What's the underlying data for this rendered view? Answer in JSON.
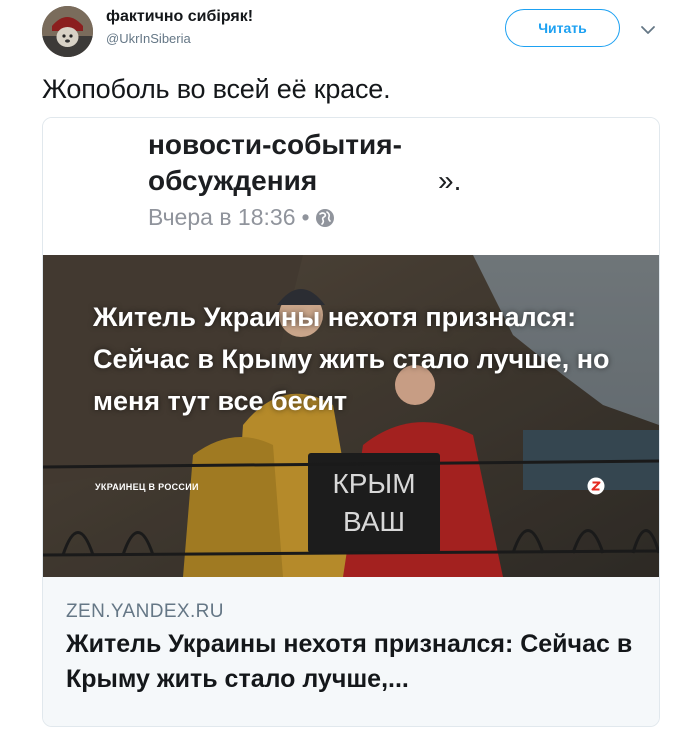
{
  "user": {
    "display_name": "фактично сибіряк!",
    "handle": "@UkrInSiberia"
  },
  "follow_button": {
    "label": "Читать",
    "color": "#1da1f2"
  },
  "tweet": {
    "text": "Жопоболь во всей её красе."
  },
  "quoted_post": {
    "text": "новости-события-обсуждения",
    "text_tail": "».",
    "time": "Вчера в 18:36",
    "separator": "•",
    "privacy_icon": "globe-icon"
  },
  "image": {
    "headline": "Житель Украины нехотя признался: Сейчас в Крыму жить стало лучше, но меня тут все бесит",
    "source": "УКРАИНЕЦ В РОССИИ",
    "sign_line1": "КРЫМ",
    "sign_line2": "ВАШ",
    "brand_icon": "zen-icon"
  },
  "link_card": {
    "domain": "ZEN.YANDEX.RU",
    "title": "Житель Украины нехотя признался: Сейчас в Крыму жить стало лучше,..."
  },
  "icons": {
    "more": "chevron-down-icon"
  }
}
